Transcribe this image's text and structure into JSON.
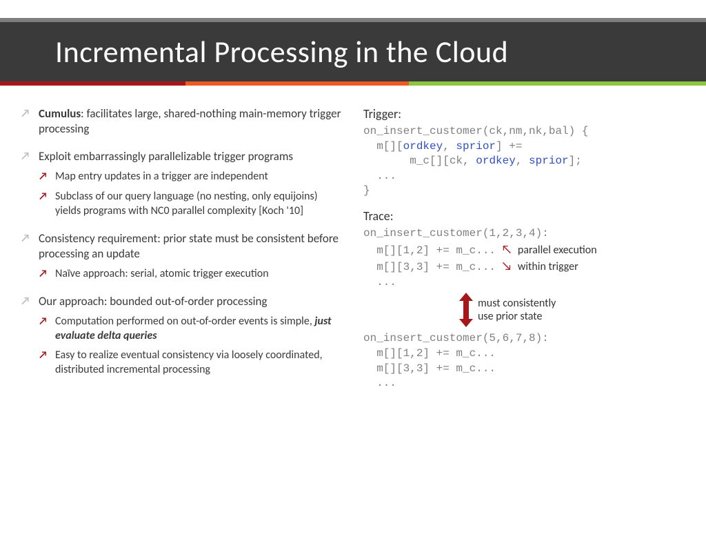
{
  "title": "Incremental Processing in the Cloud",
  "left": {
    "b1_bold": "Cumulus",
    "b1_rest": ": facilitates large, shared-nothing main-memory trigger processing",
    "b2": "Exploit embarrassingly parallelizable trigger programs",
    "b2s1": "Map entry updates in a trigger are independent",
    "b2s2": "Subclass of our query language (no nesting, only equijoins) yields programs with NC0 parallel complexity [Koch '10]",
    "b3": "Consistency requirement: prior state must be consistent before processing an update",
    "b3s1": "Naïve approach: serial, atomic trigger execution",
    "b4": "Our approach: bounded out-of-order processing",
    "b4s1a": "Computation performed on out-of-order events is simple, ",
    "b4s1b": "just evaluate delta queries",
    "b4s2": "Easy to realize eventual consistency via loosely coordinated, distributed incremental processing"
  },
  "right": {
    "trigger_heading": "Trigger:",
    "trig_l1a": "on_insert_customer(ck,nm,nk,bal) {",
    "trig_l2a": "  m[][",
    "trig_l2b": "ordkey",
    "trig_l2c": ", ",
    "trig_l2d": "sprior",
    "trig_l2e": "] +=",
    "trig_l3a": "       m_c[][ck, ",
    "trig_l3b": "ordkey",
    "trig_l3c": ", ",
    "trig_l3d": "sprior",
    "trig_l3e": "];",
    "trig_l4": "  ...",
    "trig_l5": "}",
    "trace_heading": "Trace:",
    "trace1_call": "on_insert_customer(1,2,3,4):",
    "trace1_l1": "  m[][1,2] += m_c...",
    "trace1_l2": "  m[][3,3] += m_c...",
    "trace1_l3": "  ...",
    "annot1a": "parallel execution",
    "annot1b": "within trigger",
    "annot2a": "must consistently",
    "annot2b": "use prior state",
    "trace2_call": "on_insert_customer(5,6,7,8):",
    "trace2_l1": "  m[][1,2] += m_c...",
    "trace2_l2": "  m[][3,3] += m_c...",
    "trace2_l3": "  ..."
  }
}
